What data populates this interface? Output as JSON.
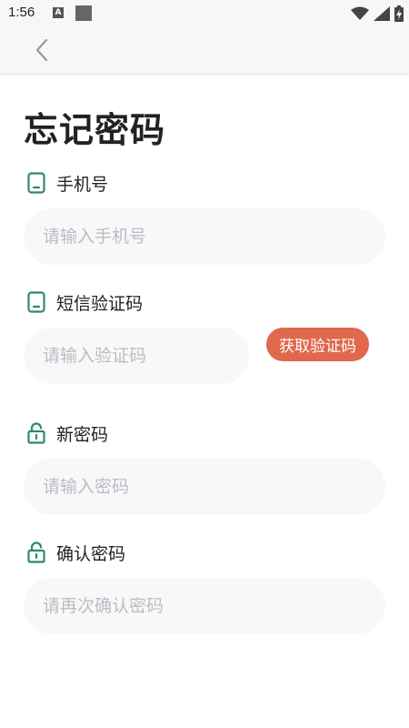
{
  "status_bar": {
    "time": "1:56",
    "a_icon_letter": "A",
    "icons": [
      "a-icon",
      "notification-square-icon",
      "wifi-icon",
      "signal-icon",
      "battery-icon"
    ]
  },
  "app_bar": {
    "back_icon": "chevron-left-icon"
  },
  "page": {
    "title": "忘记密码"
  },
  "form": {
    "phone": {
      "label": "手机号",
      "placeholder": "请输入手机号",
      "icon": "phone-icon"
    },
    "sms_code": {
      "label": "短信验证码",
      "placeholder": "请输入验证码",
      "icon": "phone-icon",
      "button_label": "获取验证码"
    },
    "new_password": {
      "label": "新密码",
      "placeholder": "请输入密码",
      "icon": "lock-icon"
    },
    "confirm_password": {
      "label": "确认密码",
      "placeholder": "请再次确认密码",
      "icon": "lock-icon"
    }
  },
  "colors": {
    "accent_button": "#e0684c",
    "icon_green": "#2e8b62",
    "input_bg": "#f8f8f8",
    "placeholder": "#b9bdc6"
  }
}
